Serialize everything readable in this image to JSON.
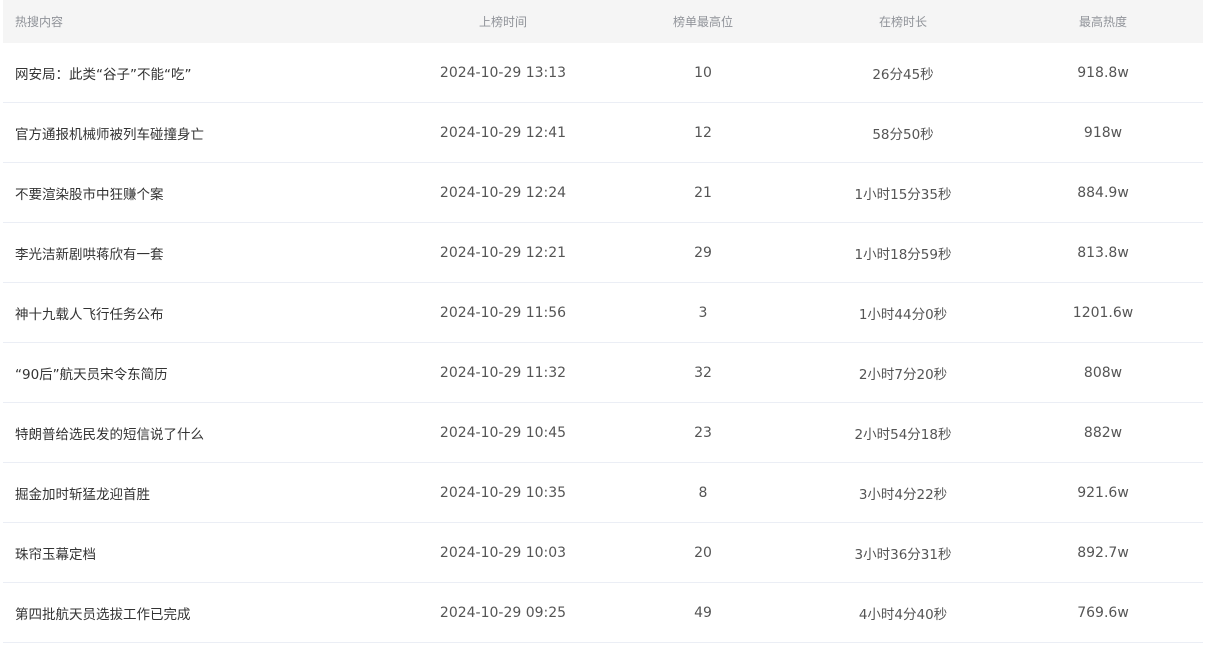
{
  "table": {
    "headers": [
      "热搜内容",
      "上榜时间",
      "榜单最高位",
      "在榜时长",
      "最高热度"
    ],
    "rows": [
      {
        "title": "网安局：此类“谷子”不能“吃”",
        "time": "2024-10-29 13:13",
        "rank": "10",
        "duration": "26分45秒",
        "heat": "918.8w"
      },
      {
        "title": "官方通报机械师被列车碰撞身亡",
        "time": "2024-10-29 12:41",
        "rank": "12",
        "duration": "58分50秒",
        "heat": "918w"
      },
      {
        "title": "不要渲染股市中狂赚个案",
        "time": "2024-10-29 12:24",
        "rank": "21",
        "duration": "1小时15分35秒",
        "heat": "884.9w"
      },
      {
        "title": "李光洁新剧哄蒋欣有一套",
        "time": "2024-10-29 12:21",
        "rank": "29",
        "duration": "1小时18分59秒",
        "heat": "813.8w"
      },
      {
        "title": "神十九载人飞行任务公布",
        "time": "2024-10-29 11:56",
        "rank": "3",
        "duration": "1小时44分0秒",
        "heat": "1201.6w"
      },
      {
        "title": "“90后”航天员宋令东简历",
        "time": "2024-10-29 11:32",
        "rank": "32",
        "duration": "2小时7分20秒",
        "heat": "808w"
      },
      {
        "title": "特朗普给选民发的短信说了什么",
        "time": "2024-10-29 10:45",
        "rank": "23",
        "duration": "2小时54分18秒",
        "heat": "882w"
      },
      {
        "title": "掘金加时斩猛龙迎首胜",
        "time": "2024-10-29 10:35",
        "rank": "8",
        "duration": "3小时4分22秒",
        "heat": "921.6w"
      },
      {
        "title": "珠帘玉幕定档",
        "time": "2024-10-29 10:03",
        "rank": "20",
        "duration": "3小时36分31秒",
        "heat": "892.7w"
      },
      {
        "title": "第四批航天员选拔工作已完成",
        "time": "2024-10-29 09:25",
        "rank": "49",
        "duration": "4小时4分40秒",
        "heat": "769.6w"
      }
    ]
  }
}
